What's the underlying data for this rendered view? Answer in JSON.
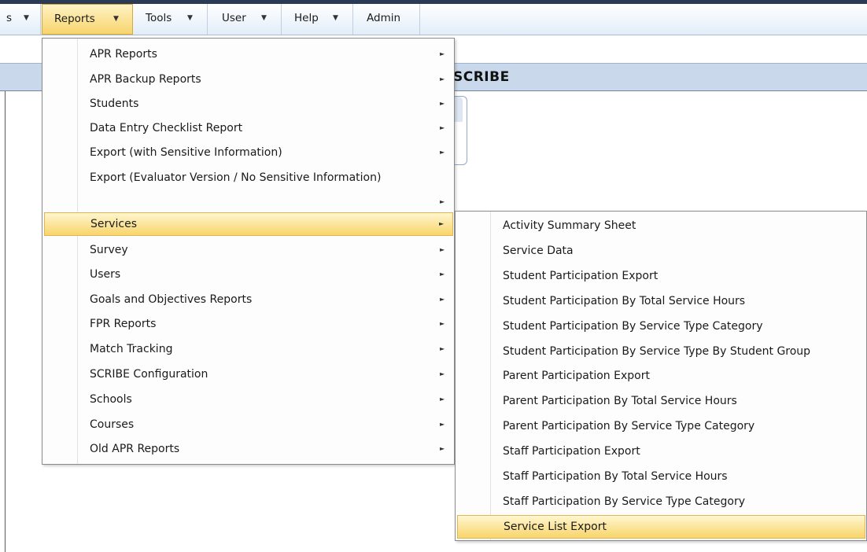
{
  "menubar": {
    "items": [
      {
        "label": "s",
        "arrow": "▼"
      },
      {
        "label": "Reports",
        "arrow": "▼"
      },
      {
        "label": "Tools",
        "arrow": "▼"
      },
      {
        "label": "User",
        "arrow": "▼"
      },
      {
        "label": "Help",
        "arrow": "▼"
      },
      {
        "label": "Admin",
        "arrow": ""
      }
    ],
    "active_index": 1
  },
  "section": {
    "title_fragment": "SCRIBE"
  },
  "reports_menu": {
    "submenu_arrow": "►",
    "items": [
      {
        "label": "APR Reports",
        "has_submenu": true
      },
      {
        "label": "APR Backup Reports",
        "has_submenu": true
      },
      {
        "label": "Students",
        "has_submenu": true
      },
      {
        "label": "Data Entry Checklist Report",
        "has_submenu": true
      },
      {
        "label": "Export (with Sensitive Information)",
        "has_submenu": true
      },
      {
        "label": "Export (Evaluator Version / No Sensitive Information)",
        "has_submenu": false
      },
      {
        "label": "",
        "has_submenu": true
      },
      {
        "label": "Services",
        "has_submenu": true,
        "highlighted": true
      },
      {
        "label": "Survey",
        "has_submenu": true
      },
      {
        "label": "Users",
        "has_submenu": true
      },
      {
        "label": "Goals and Objectives Reports",
        "has_submenu": true
      },
      {
        "label": "FPR Reports",
        "has_submenu": true
      },
      {
        "label": "Match Tracking",
        "has_submenu": true
      },
      {
        "label": "SCRIBE Configuration",
        "has_submenu": true
      },
      {
        "label": "Schools",
        "has_submenu": true
      },
      {
        "label": "Courses",
        "has_submenu": true
      },
      {
        "label": "Old APR Reports",
        "has_submenu": true
      }
    ]
  },
  "services_menu": {
    "items": [
      {
        "label": "Activity Summary Sheet"
      },
      {
        "label": "Service Data"
      },
      {
        "label": "Student Participation Export"
      },
      {
        "label": "Student Participation By Total Service Hours"
      },
      {
        "label": "Student Participation By Service Type Category"
      },
      {
        "label": "Student Participation By Service Type By Student Group"
      },
      {
        "label": "Parent Participation Export"
      },
      {
        "label": "Parent Participation By Total Service Hours"
      },
      {
        "label": "Parent Participation By Service Type Category"
      },
      {
        "label": "Staff Participation Export"
      },
      {
        "label": "Staff Participation By Total Service Hours"
      },
      {
        "label": "Staff Participation By Service Type Category"
      },
      {
        "label": "Service List Export",
        "highlighted": true
      }
    ]
  },
  "colors": {
    "highlight": "#f8d56b",
    "header_band": "#c9d8ea",
    "menubar_bg": "#e2edf9"
  }
}
